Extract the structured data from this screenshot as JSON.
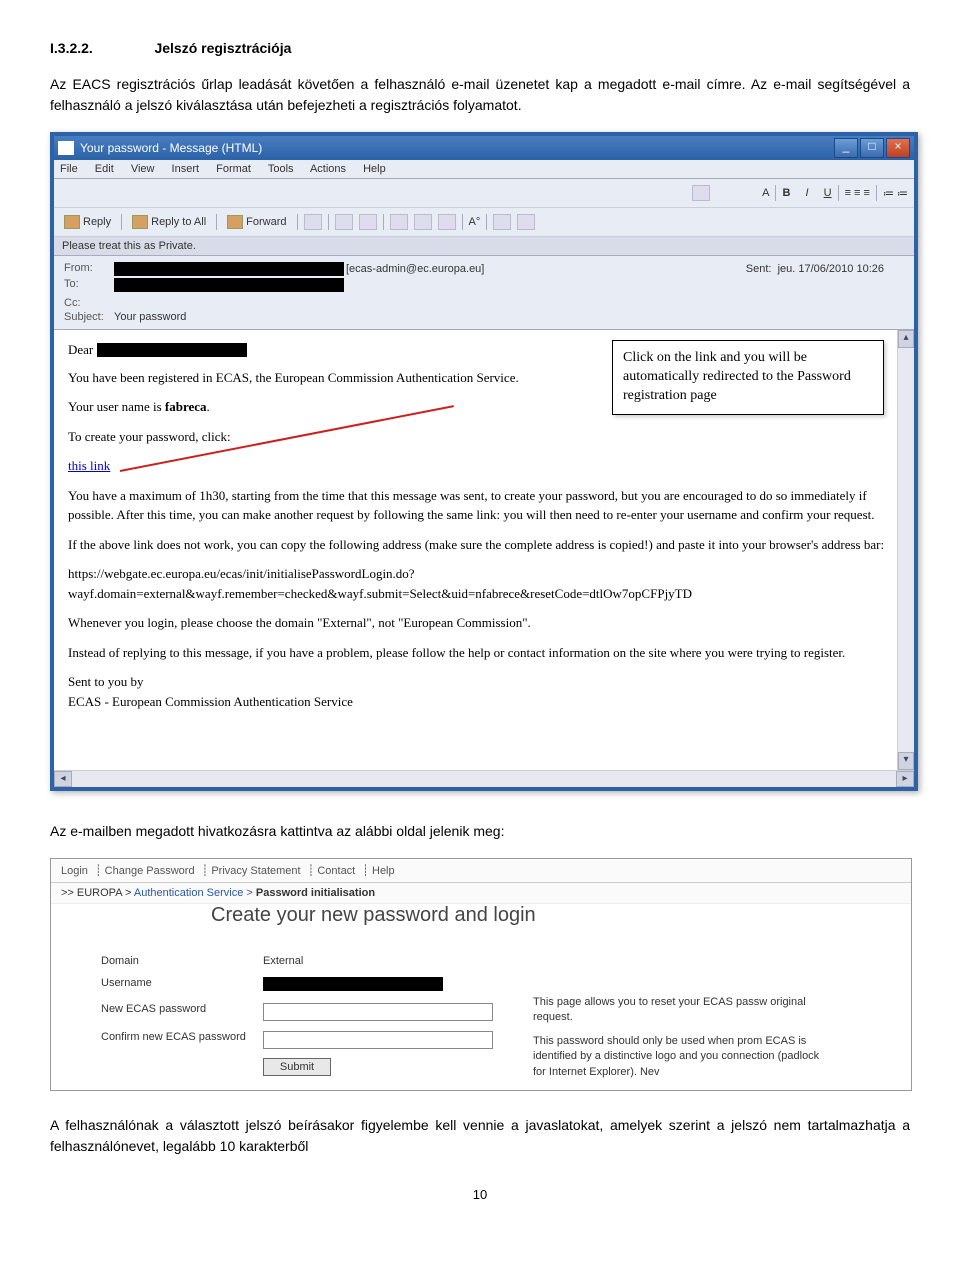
{
  "section": {
    "number": "I.3.2.2.",
    "title": "Jelszó regisztrációja"
  },
  "intro_para": "Az EACS regisztrációs űrlap leadását követően a felhasználó e-mail üzenetet kap a megadott e-mail címre. Az e-mail segítségével a felhasználó a jelszó kiválasztása után befejezheti a regisztrációs folyamatot.",
  "outlook": {
    "title": "Your password - Message (HTML)",
    "menu": [
      "File",
      "Edit",
      "View",
      "Insert",
      "Format",
      "Tools",
      "Actions",
      "Help"
    ],
    "toolbar": {
      "reply": "Reply",
      "reply_all": "Reply to All",
      "forward": "Forward"
    },
    "privacy_notice": "Please treat this as Private.",
    "headers": {
      "from_label": "From:",
      "from_suffix": "[ecas-admin@ec.europa.eu]",
      "sent_label": "Sent:",
      "sent_value": "jeu. 17/06/2010 10:26",
      "to_label": "To:",
      "cc_label": "Cc:",
      "subject_label": "Subject:",
      "subject_value": "Your password"
    },
    "body": {
      "dear": "Dear",
      "p1": "You have been registered in ECAS, the European Commission Authentication Service.",
      "username_line_prefix": "Your user name is ",
      "username_value": "fabreca",
      "username_line_suffix": ".",
      "p2": "To create your password, click:",
      "link_text": "this link",
      "p3": "You have a maximum of 1h30, starting from the time that this message was sent, to create your password, but you are encouraged to do so immediately if possible. After this time, you can make another request by following the same link: you will then need to re-enter your username and confirm your request.",
      "p4": "If the above link does not work, you can copy the following address (make sure the complete address is copied!) and paste it into your browser's address bar:",
      "url1": "https://webgate.ec.europa.eu/ecas/init/initialisePasswordLogin.do?",
      "url2": "wayf.domain=external&wayf.remember=checked&wayf.submit=Select&uid=nfabrece&resetCode=dtlOw7opCFPjyTD",
      "p5": "Whenever you login, please choose the domain \"External\", not \"European Commission\".",
      "p6": "Instead of replying to this message, if you have a problem, please follow the help or contact information on the site where you were trying to register.",
      "signoff1": "Sent to you by",
      "signoff2": "ECAS - European Commission Authentication Service"
    },
    "callout": "Click on the link and you will be automatically redirected to the Password registration page"
  },
  "middle_para": "Az e-mailben megadott hivatkozásra kattintva az alábbi oldal jelenik meg:",
  "ecas": {
    "menu": [
      "Login",
      "Change Password",
      "Privacy Statement",
      "Contact",
      "Help"
    ],
    "crumbs_prefix": ">> EUROPA >",
    "crumbs_mid": "Authentication Service >",
    "crumbs_last": "Password initialisation",
    "form_title": "Create your new password and login",
    "labels": {
      "domain": "Domain",
      "username": "Username",
      "newpw": "New ECAS password",
      "confirmpw": "Confirm new ECAS password",
      "submit": "Submit"
    },
    "domain_value": "External",
    "right_text1": "This page allows you to reset your ECAS passw original request.",
    "right_text2": "This password should only be used when prom ECAS is identified by a distinctive logo and you connection (padlock for Internet Explorer). Nev"
  },
  "closing_para": "A felhasználónak a választott jelszó beírásakor figyelembe kell vennie a javaslatokat, amelyek szerint a jelszó nem tartalmazhatja a felhasználónevet, legalább 10 karakterből",
  "page_number": "10"
}
